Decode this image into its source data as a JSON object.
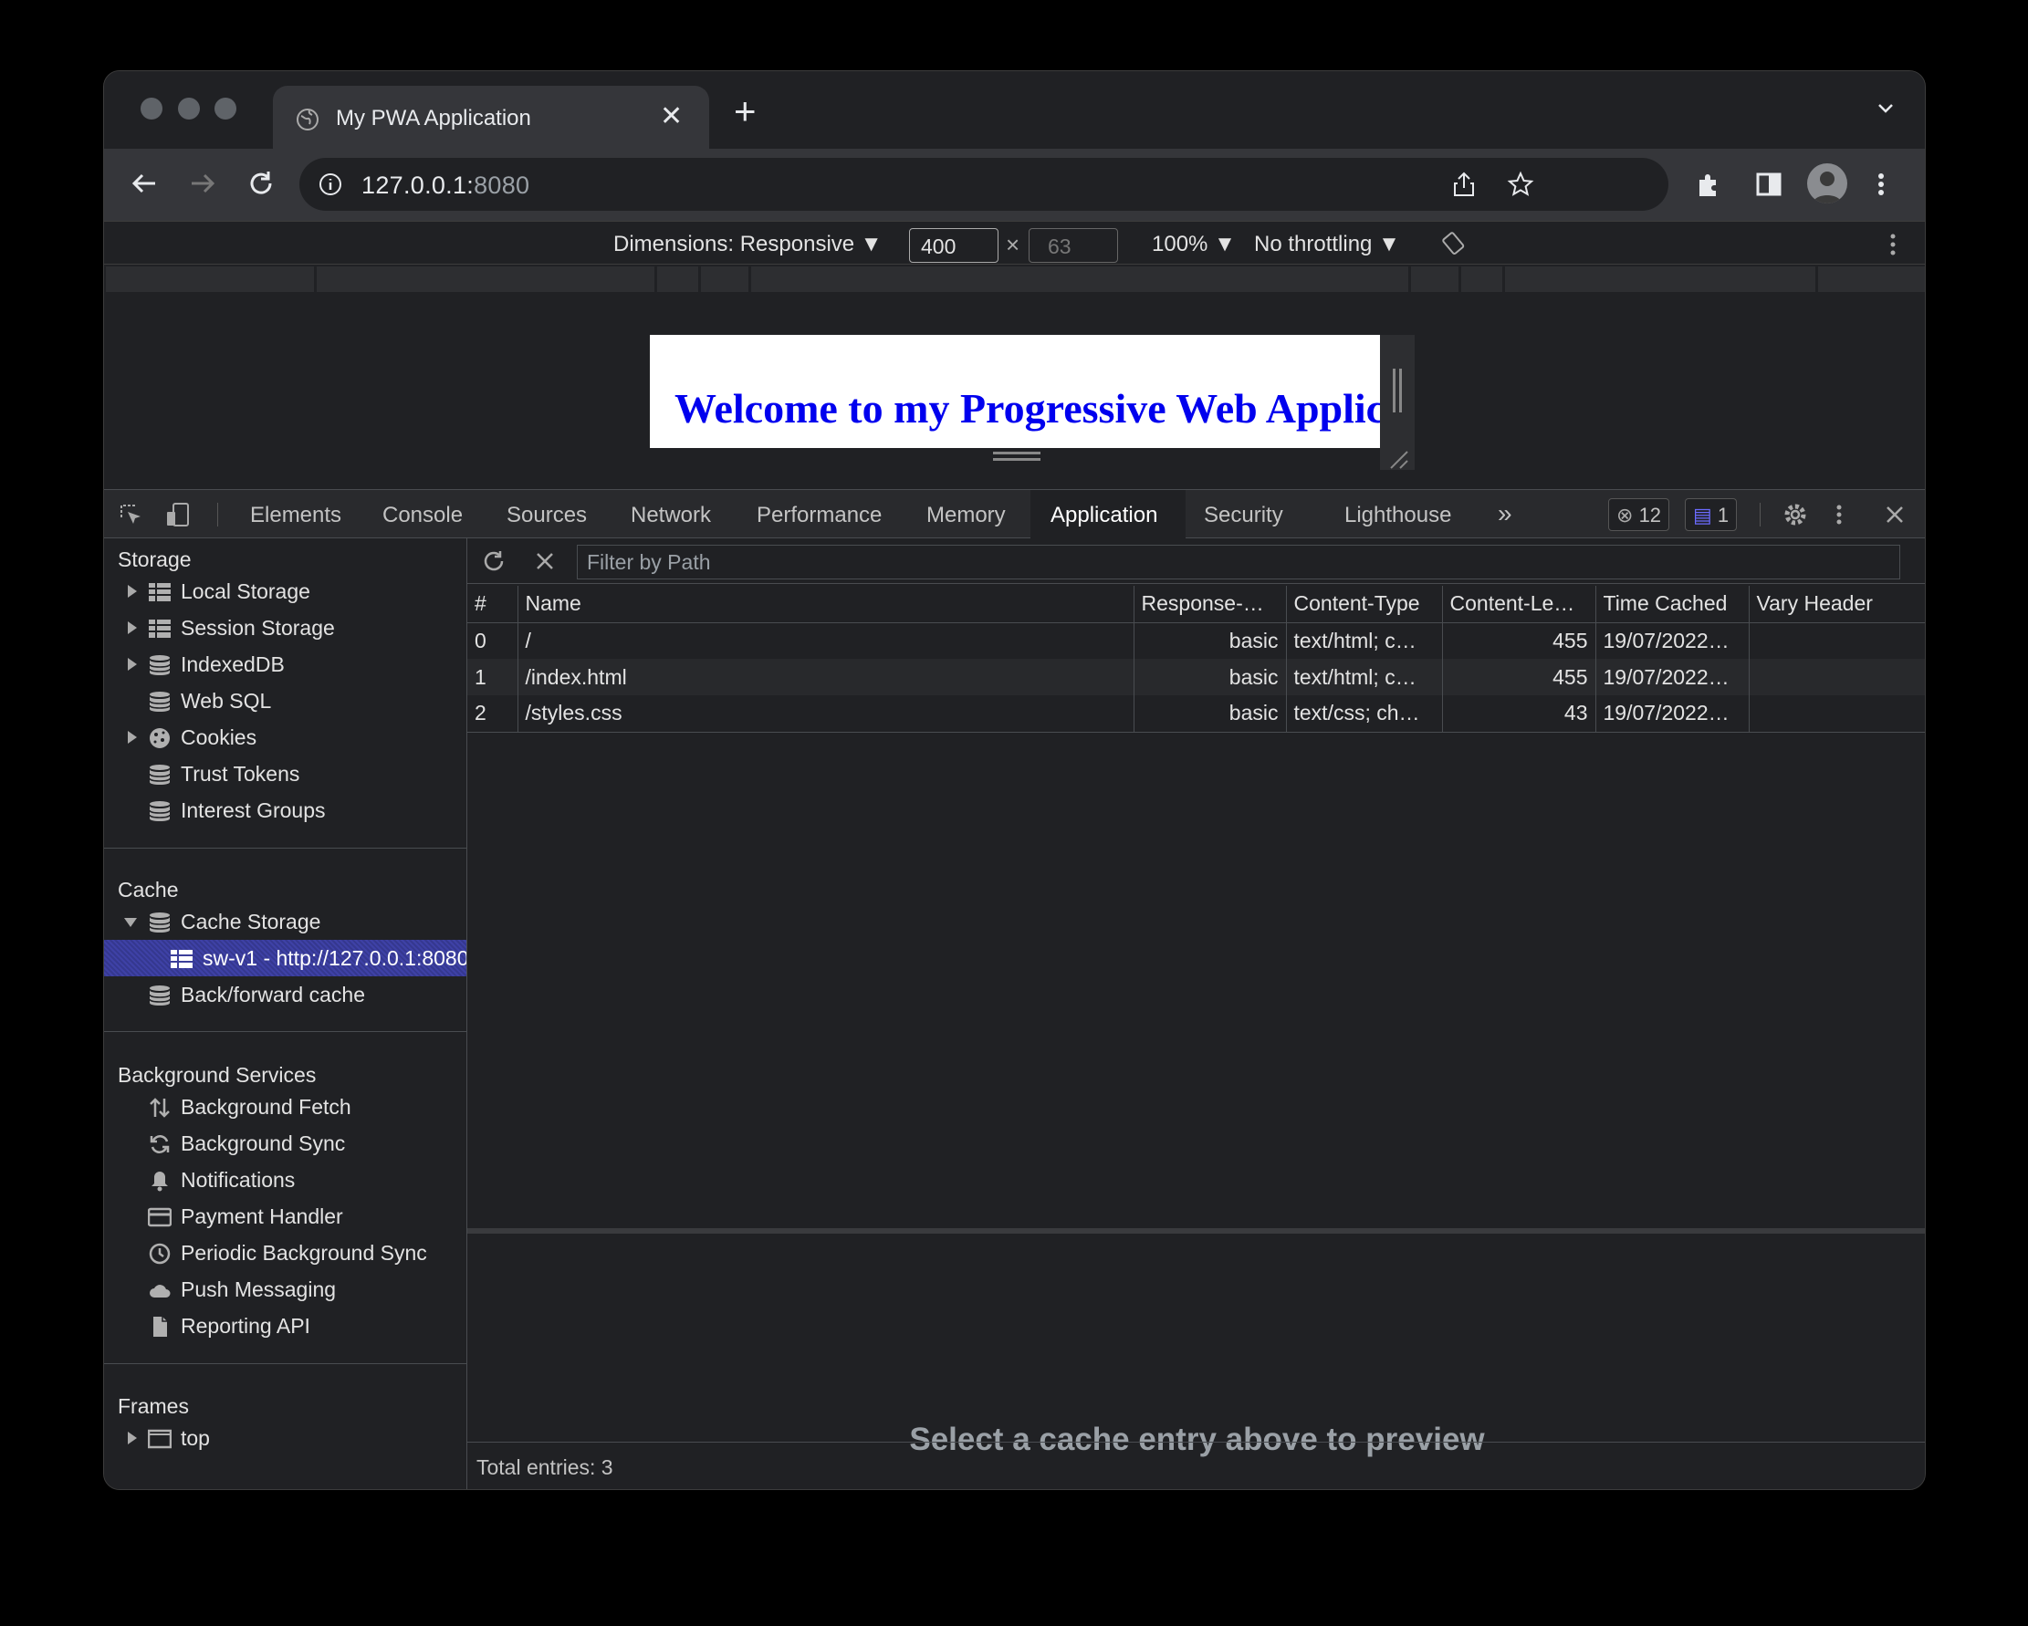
{
  "browser": {
    "tab_title": "My PWA Application",
    "url_host": "127.0.0.1:",
    "url_port": "8080"
  },
  "device_toolbar": {
    "dimensions_label": "Dimensions: Responsive",
    "width_value": "400",
    "times": "×",
    "height_value": "63",
    "zoom": "100%",
    "throttling": "No throttling"
  },
  "page": {
    "heading": "Welcome to my Progressive Web Application"
  },
  "devtools": {
    "tabs": [
      "Elements",
      "Console",
      "Sources",
      "Network",
      "Performance",
      "Memory",
      "Application",
      "Security",
      "Lighthouse"
    ],
    "active_tab": "Application",
    "error_count": "12",
    "message_count": "1"
  },
  "sidebar": {
    "storage_header": "Storage",
    "storage_items": [
      "Local Storage",
      "Session Storage",
      "IndexedDB",
      "Web SQL",
      "Cookies",
      "Trust Tokens",
      "Interest Groups"
    ],
    "cache_header": "Cache",
    "cache_storage": "Cache Storage",
    "cache_entry": "sw-v1 - http://127.0.0.1:8080",
    "bf_cache": "Back/forward cache",
    "bg_header": "Background Services",
    "bg_items": [
      "Background Fetch",
      "Background Sync",
      "Notifications",
      "Payment Handler",
      "Periodic Background Sync",
      "Push Messaging",
      "Reporting API"
    ],
    "frames_header": "Frames",
    "frames_top": "top"
  },
  "cache_view": {
    "filter_placeholder": "Filter by Path",
    "columns": [
      "#",
      "Name",
      "Response-…",
      "Content-Type",
      "Content-Le…",
      "Time Cached",
      "Vary Header"
    ],
    "rows": [
      [
        "0",
        "/",
        "basic",
        "text/html; c…",
        "455",
        "19/07/2022…",
        ""
      ],
      [
        "1",
        "/index.html",
        "basic",
        "text/html; c…",
        "455",
        "19/07/2022…",
        ""
      ],
      [
        "2",
        "/styles.css",
        "basic",
        "text/css; ch…",
        "43",
        "19/07/2022…",
        ""
      ]
    ],
    "preview_message": "Select a cache entry above to preview",
    "total_entries": "Total entries: 3"
  }
}
